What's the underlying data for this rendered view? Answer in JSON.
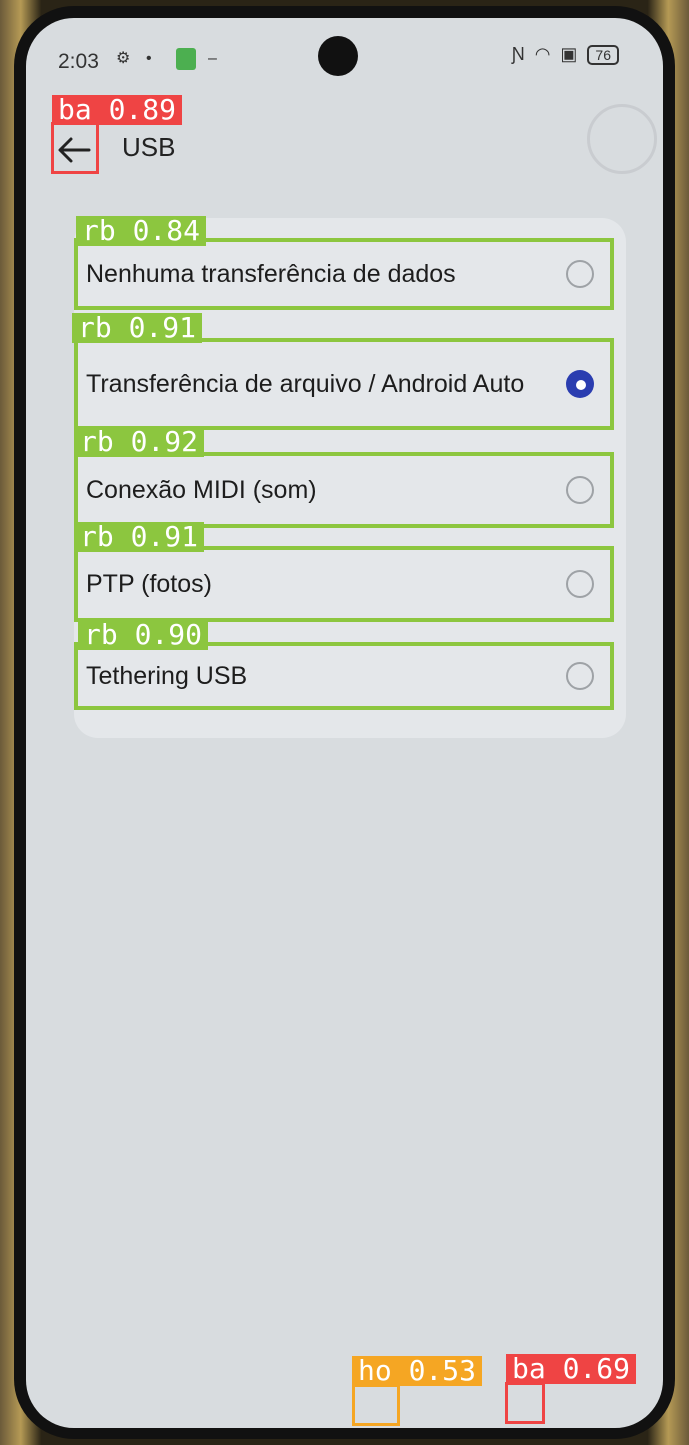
{
  "status": {
    "time": "2:03",
    "battery": "76"
  },
  "appbar": {
    "title": "USB"
  },
  "options": [
    {
      "label": "Nenhuma transferência de dados",
      "selected": false,
      "tag": "rb 0.84"
    },
    {
      "label": "Transferência de arquivo / Android Auto",
      "selected": true,
      "tag": "rb 0.91"
    },
    {
      "label": "Conexão MIDI (som)",
      "selected": false,
      "tag": "rb 0.92"
    },
    {
      "label": "PTP (fotos)",
      "selected": false,
      "tag": "rb 0.91"
    },
    {
      "label": "Tethering USB",
      "selected": false,
      "tag": "rb 0.90"
    }
  ],
  "detections": {
    "back": "ba 0.89",
    "home": "ho 0.53",
    "nav_back": "ba 0.69"
  },
  "colors": {
    "accent": "#2a3db0",
    "detection_green": "#8cc63f",
    "detection_red": "#ef4444",
    "detection_orange": "#f5a623"
  }
}
